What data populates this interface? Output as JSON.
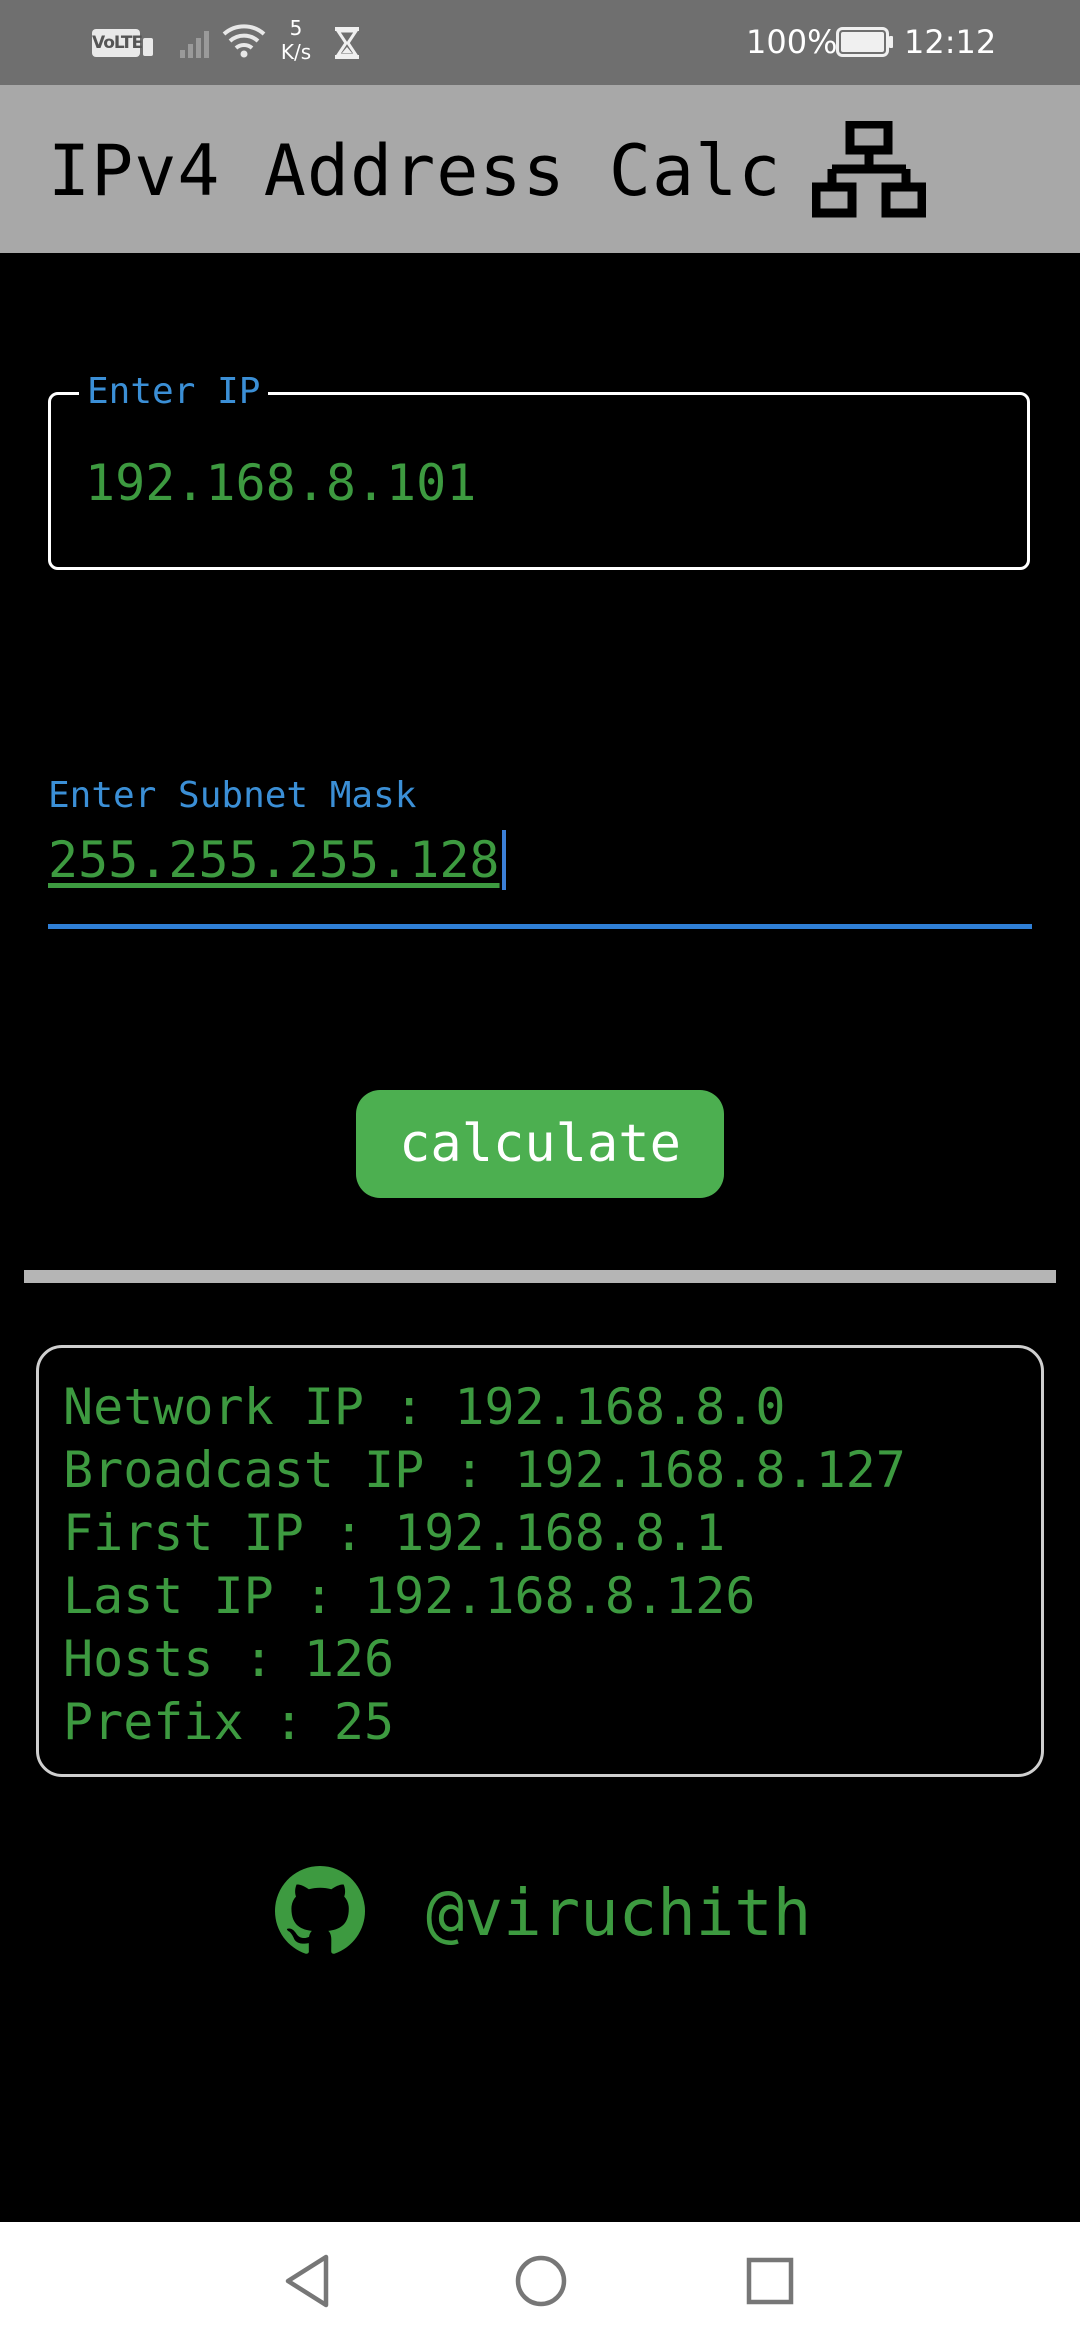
{
  "status_bar": {
    "volte": "VoLTE",
    "speed_value": "5",
    "speed_unit": "K/s",
    "battery_percent": "100%",
    "time": "12:12"
  },
  "app_bar": {
    "title": "IPv4 Address Calc",
    "icon": "network-icon"
  },
  "ip_field": {
    "label": "Enter IP",
    "value": "192.168.8.101"
  },
  "mask_field": {
    "label": "Enter Subnet Mask",
    "value": "255.255.255.128"
  },
  "calculate_button": {
    "label": "calculate"
  },
  "results": [
    "Network IP : 192.168.8.0",
    "Broadcast IP : 192.168.8.127",
    "First IP : 192.168.8.1",
    "Last IP : 192.168.8.126",
    "Hosts : 126",
    "Prefix : 25"
  ],
  "footer": {
    "icon": "github-icon",
    "handle": "@viruchith"
  },
  "colors": {
    "app_bar_bg": "#a8a8a8",
    "accent_blue": "#3b8fd6",
    "text_green": "#3d9a40",
    "button_green": "#4caf50",
    "background": "#000000"
  },
  "nav_bar": {
    "icons": [
      "back-icon",
      "home-icon",
      "recents-icon"
    ]
  }
}
